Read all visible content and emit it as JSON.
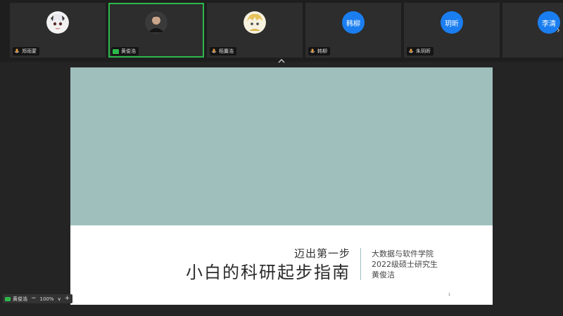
{
  "participants": [
    {
      "name": "郑雨蒙",
      "avatar_type": "image",
      "avatar_icon": "anime-girl-avatar",
      "status_icon": "mic-icon"
    },
    {
      "name": "黄俊浩",
      "avatar_type": "image",
      "avatar_icon": "person-photo-avatar",
      "status_icon": "camera-icon",
      "active": true
    },
    {
      "name": "栢麋浩",
      "avatar_type": "image",
      "avatar_icon": "cartoon-avatar",
      "status_icon": "mic-icon"
    },
    {
      "name": "韩柳",
      "avatar_type": "text",
      "avatar_text": "韩柳",
      "status_icon": "mic-icon"
    },
    {
      "name": "朱玥昕",
      "avatar_type": "text",
      "avatar_text": "玥昕",
      "status_icon": "mic-icon"
    },
    {
      "name": "",
      "avatar_type": "text",
      "avatar_text": "李清",
      "status_icon": ""
    }
  ],
  "colors": {
    "accent_green": "#2db84b",
    "avatar_blue": "#1a7ef0",
    "slide_band": "#9fbfbd"
  },
  "slide": {
    "subtitle": "迈出第一步",
    "title": "小白的科研起步指南",
    "info_line1": "大数据与软件学院",
    "info_line2": "2022级硕士研究生",
    "info_line3": "黄俊洁",
    "page_number": "1"
  },
  "self_view": {
    "name": "黄俊浩"
  },
  "zoom": {
    "minus": "−",
    "value": "100%",
    "dropdown": "∨",
    "plus": "+"
  }
}
